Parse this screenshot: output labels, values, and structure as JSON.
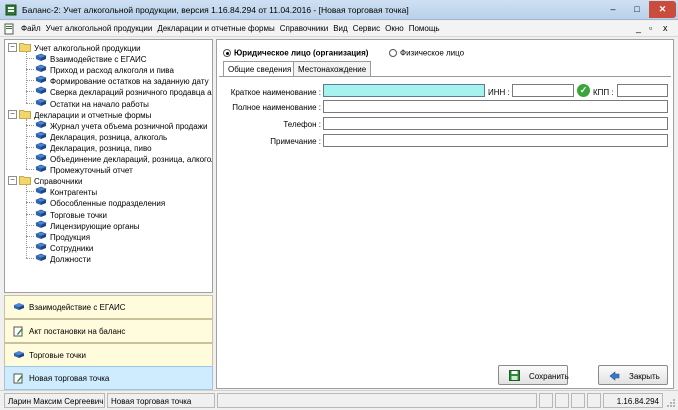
{
  "window": {
    "title": "Баланс-2: Учет алкогольной продукции, версия 1.16.84.294 от 11.04.2016 - [Новая торговая точка]",
    "min_glyph": "–",
    "max_glyph": "□",
    "close_glyph": "✕"
  },
  "menu": {
    "items": [
      "Файл",
      "Учет алкогольной продукции",
      "Декларации и отчетные формы",
      "Справочники",
      "Вид",
      "Сервис",
      "Окно",
      "Помощь"
    ],
    "mdi_min": "_",
    "mdi_restore": "▫",
    "mdi_close": "x"
  },
  "tree": {
    "groups": [
      {
        "label": "Учет алкогольной продукции",
        "expander": "−",
        "items": [
          "Взаимодействие с ЕГАИС",
          "Приход и расход алкоголя и пива",
          "Формирование остатков на заданную дату",
          "Сверка деклараций розничного продавца алк",
          "Остатки на начало работы"
        ]
      },
      {
        "label": "Декларации и отчетные формы",
        "expander": "−",
        "items": [
          "Журнал учета объема розничной продажи",
          "Декларация, розница, алкоголь",
          "Декларация, розница, пиво",
          "Объединение деклараций, розница, алкоголь",
          "Промежуточный отчет"
        ]
      },
      {
        "label": "Справочники",
        "expander": "−",
        "items": [
          "Контрагенты",
          "Обособленные подразделения",
          "Торговые точки",
          "Лицензирующие органы",
          "Продукция",
          "Сотрудники",
          "Должности"
        ]
      }
    ]
  },
  "nav_buttons": [
    {
      "label": "Взаимодействие с ЕГАИС",
      "active": false
    },
    {
      "label": "Акт постановки на баланс",
      "active": false
    },
    {
      "label": "Торговые точки",
      "active": false
    },
    {
      "label": "Новая торговая точка",
      "active": true
    }
  ],
  "form": {
    "radio_legal": "Юридическое лицо (организация)",
    "radio_individual": "Физическое лицо",
    "tabs": [
      "Общие сведения",
      "Местонахождение"
    ],
    "short_name_label": "Краткое наименование :",
    "short_name_value": "",
    "inn_label": "ИНН :",
    "inn_value": "",
    "check_glyph": "✓",
    "kpp_label": "КПП :",
    "kpp_value": "",
    "full_name_label": "Полное наименование :",
    "full_name_value": "",
    "phone_label": "Телефон :",
    "phone_value": "",
    "note_label": "Примечание :",
    "note_value": ""
  },
  "buttons": {
    "save": "Сохранить",
    "close": "Закрыть"
  },
  "status": {
    "user": "Ларин Максим Сергеевич",
    "context": "Новая торговая точка",
    "version": "1.16.84.294"
  },
  "colors": {
    "focus_input": "#a6f2ee",
    "active_nav": "#cfecff",
    "nav_bg": "#fffbdc",
    "titlebar": "#b9d1ea",
    "close_button": "#c94c3c"
  },
  "icons": {
    "tree_group": "folder-icon",
    "tree_item": "document-icon",
    "save": "floppy-disk-icon",
    "close": "door-exit-icon"
  }
}
